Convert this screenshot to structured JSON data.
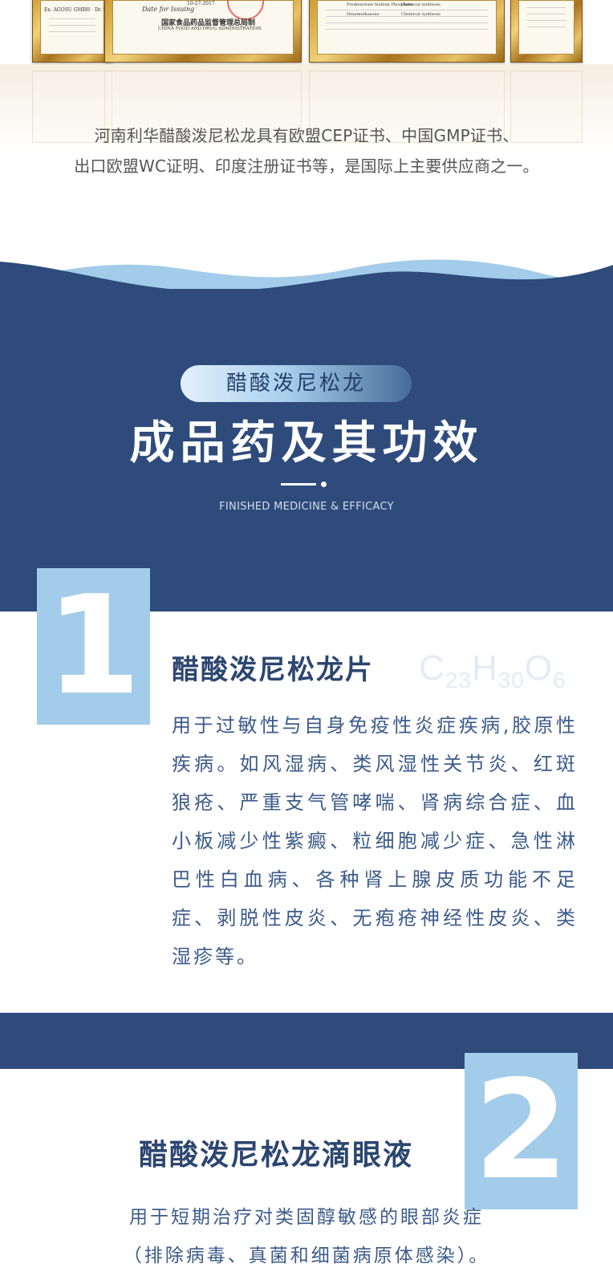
{
  "certificates": {
    "cert_a_text": "Ex. AGOSU GMBH · Dr. Sta",
    "cert_b_date": "Date for Issuing",
    "cert_b_number": "10-27-2017",
    "cert_b_issuer_cn": "国家食品药品监督管理总局制",
    "cert_b_issuer_en": "CHINA FOOD AND DRUG ADMINISTRATION",
    "cert_c_row1_name": "Prednisolone Sodium Phosphate",
    "cert_c_row1_method": "Chemical synthesis",
    "cert_c_row2_name": "Dexamethasone",
    "cert_c_row2_method": "Chemical synthesis"
  },
  "intro": {
    "line1": "河南利华醋酸泼尼松龙具有欧盟CEP证书、中国GMP证书、",
    "line2": "出口欧盟WC证明、印度注册证书等，是国际上主要供应商之一。"
  },
  "header": {
    "pill_label": "醋酸泼尼松龙",
    "title": "成品药及其功效",
    "subtitle_en": "FINISHED MEDICINE & EFFICACY"
  },
  "item1": {
    "number": "1",
    "title": "醋酸泼尼松龙片",
    "formula": {
      "c": "C",
      "c_n": "23",
      "h": "H",
      "h_n": "30",
      "o": "O",
      "o_n": "6"
    },
    "description": "用于过敏性与自身免疫性炎症疾病,胶原性疾病。如风湿病、类风湿性关节炎、红斑狼疮、严重支气管哮喘、肾病综合症、血小板减少性紫癜、粒细胞减少症、急性淋巴性白血病、各种肾上腺皮质功能不足症、剥脱性皮炎、无疱疮神经性皮炎、类湿疹等。"
  },
  "item2": {
    "number": "2",
    "title": "醋酸泼尼松龙滴眼液",
    "desc_line1": "用于短期治疗对类固醇敏感的眼部炎症",
    "desc_line2": "（排除病毒、真菌和细菌病原体感染）。"
  },
  "colors": {
    "navy": "#2e4b7b",
    "light_blue": "#a2cce9",
    "title_blue": "#2c4670",
    "text_blue": "#3c5b8a"
  }
}
